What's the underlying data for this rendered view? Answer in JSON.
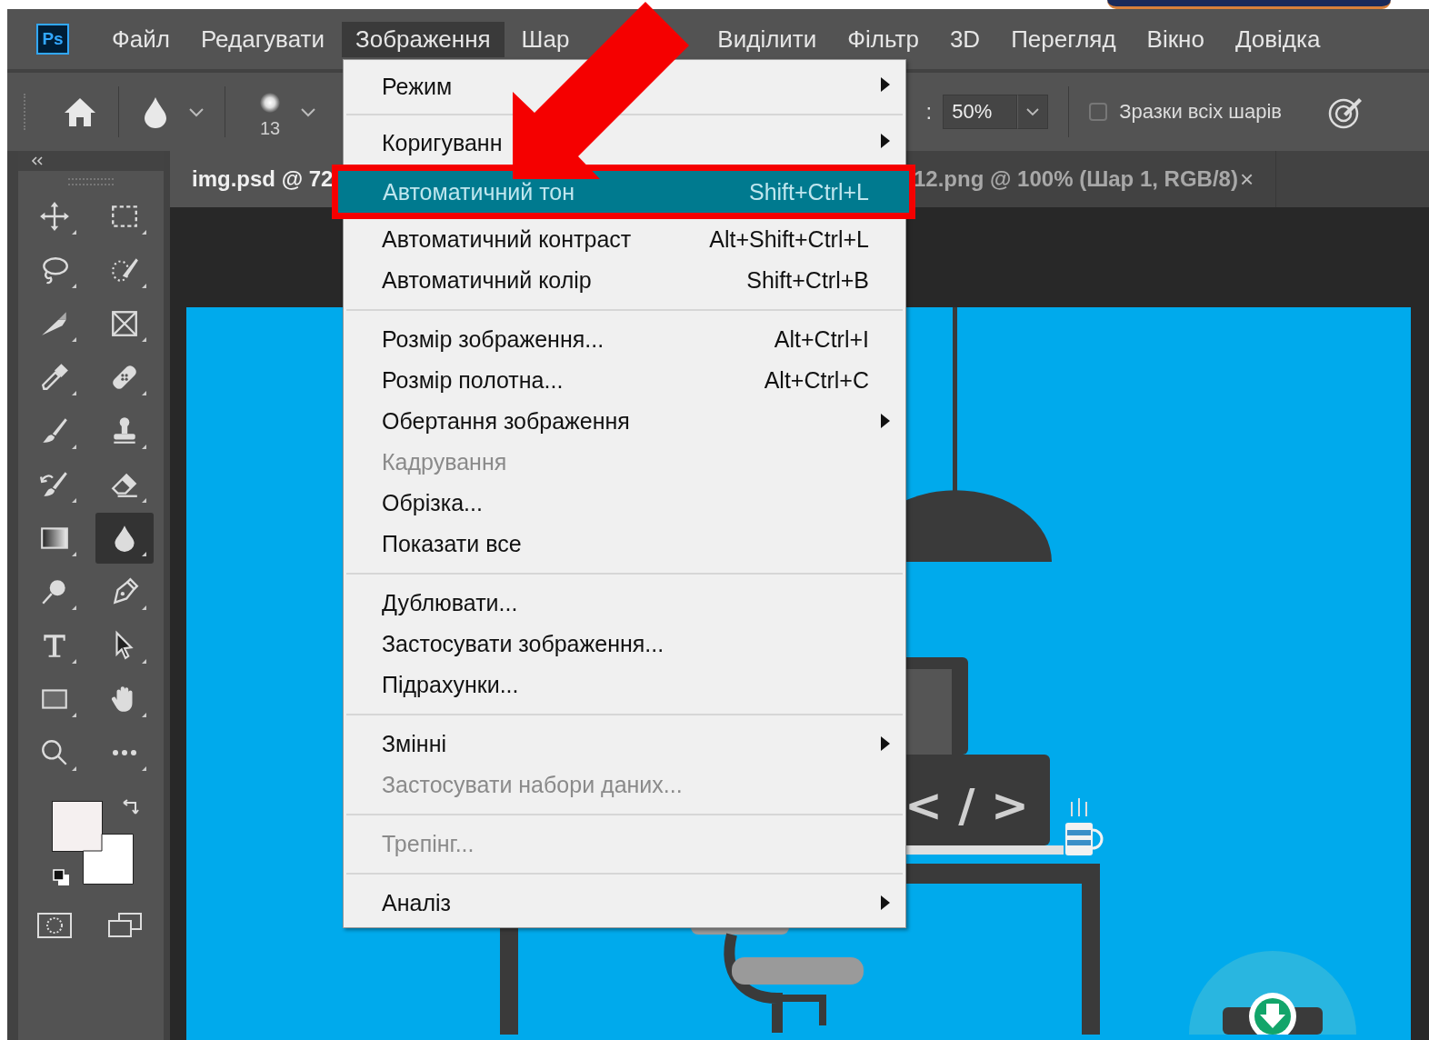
{
  "app_logo": "Ps",
  "menu_bar": [
    {
      "label": "Файл",
      "selected": false
    },
    {
      "label": "Редагувати",
      "selected": false
    },
    {
      "label": "Зображення",
      "selected": true
    },
    {
      "label": "Шар",
      "selected": false
    },
    {
      "label": "Виділити",
      "selected": false
    },
    {
      "label": "Фільтр",
      "selected": false
    },
    {
      "label": "3D",
      "selected": false
    },
    {
      "label": "Перегляд",
      "selected": false
    },
    {
      "label": "Вікно",
      "selected": false
    },
    {
      "label": "Довідка",
      "selected": false
    }
  ],
  "options_bar": {
    "brush_size": "13",
    "field_label": ":",
    "strength": "50%",
    "sample_all_layers": {
      "label": "Зразки всіх шарів",
      "checked": false
    }
  },
  "tabs": [
    {
      "label": "img.psd @ 72",
      "selected": true
    },
    {
      "label": "12.png @ 100% (Шар 1, RGB/8)",
      "selected": false,
      "close": "×"
    }
  ],
  "tools": [
    {
      "kind": "move",
      "selected": false
    },
    {
      "kind": "marquee",
      "selected": false
    },
    {
      "kind": "lasso",
      "selected": false
    },
    {
      "kind": "quick-select",
      "selected": false
    },
    {
      "kind": "slice",
      "selected": false
    },
    {
      "kind": "frame",
      "selected": false
    },
    {
      "kind": "eyedropper",
      "selected": false
    },
    {
      "kind": "healing",
      "selected": false
    },
    {
      "kind": "brush",
      "selected": false
    },
    {
      "kind": "stamp",
      "selected": false
    },
    {
      "kind": "history-brush",
      "selected": false
    },
    {
      "kind": "eraser",
      "selected": false
    },
    {
      "kind": "gradient",
      "selected": false
    },
    {
      "kind": "blur",
      "selected": true
    },
    {
      "kind": "dodge",
      "selected": false
    },
    {
      "kind": "pen",
      "selected": false
    },
    {
      "kind": "type",
      "selected": false
    },
    {
      "kind": "path-select",
      "selected": false
    },
    {
      "kind": "rectangle",
      "selected": false
    },
    {
      "kind": "hand",
      "selected": false
    },
    {
      "kind": "zoom",
      "selected": false
    },
    {
      "kind": "more",
      "selected": false
    }
  ],
  "menu": [
    {
      "kind": "item",
      "label": "Режим",
      "submenu": true,
      "disabled": false,
      "selected": false
    },
    {
      "kind": "separator"
    },
    {
      "kind": "item",
      "label": "Коригуванн",
      "submenu": true,
      "disabled": false,
      "selected": false
    },
    {
      "kind": "item",
      "label": "Автоматичний тон",
      "shortcut": "Shift+Ctrl+L",
      "submenu": false,
      "disabled": false,
      "selected": true,
      "annotated": true
    },
    {
      "kind": "item",
      "label": "Автоматичний контраст",
      "shortcut": "Alt+Shift+Ctrl+L",
      "submenu": false,
      "disabled": false,
      "selected": false
    },
    {
      "kind": "item",
      "label": "Автоматичний колір",
      "shortcut": "Shift+Ctrl+B",
      "submenu": false,
      "disabled": false,
      "selected": false
    },
    {
      "kind": "separator"
    },
    {
      "kind": "item",
      "label": "Розмір зображення...",
      "shortcut": "Alt+Ctrl+I",
      "submenu": false,
      "disabled": false,
      "selected": false
    },
    {
      "kind": "item",
      "label": "Розмір полотна...",
      "shortcut": "Alt+Ctrl+C",
      "submenu": false,
      "disabled": false,
      "selected": false
    },
    {
      "kind": "item",
      "label": "Обертання зображення",
      "submenu": true,
      "disabled": false,
      "selected": false
    },
    {
      "kind": "item",
      "label": "Кадрування",
      "submenu": false,
      "disabled": true,
      "selected": false
    },
    {
      "kind": "item",
      "label": "Обрізка...",
      "submenu": false,
      "disabled": false,
      "selected": false
    },
    {
      "kind": "item",
      "label": "Показати все",
      "submenu": false,
      "disabled": false,
      "selected": false
    },
    {
      "kind": "separator"
    },
    {
      "kind": "item",
      "label": "Дублювати...",
      "submenu": false,
      "disabled": false,
      "selected": false
    },
    {
      "kind": "item",
      "label": "Застосувати зображення...",
      "submenu": false,
      "disabled": false,
      "selected": false
    },
    {
      "kind": "item",
      "label": "Підрахунки...",
      "submenu": false,
      "disabled": false,
      "selected": false
    },
    {
      "kind": "separator"
    },
    {
      "kind": "item",
      "label": "Змінні",
      "submenu": true,
      "disabled": false,
      "selected": false
    },
    {
      "kind": "item",
      "label": "Застосувати набори даних...",
      "submenu": false,
      "disabled": true,
      "selected": false
    },
    {
      "kind": "separator"
    },
    {
      "kind": "item",
      "label": "Трепінг...",
      "submenu": false,
      "disabled": true,
      "selected": false
    },
    {
      "kind": "separator"
    },
    {
      "kind": "item",
      "label": "Аналіз",
      "submenu": true,
      "disabled": false,
      "selected": false
    }
  ],
  "canvas": {
    "code_sign": "< / >"
  }
}
